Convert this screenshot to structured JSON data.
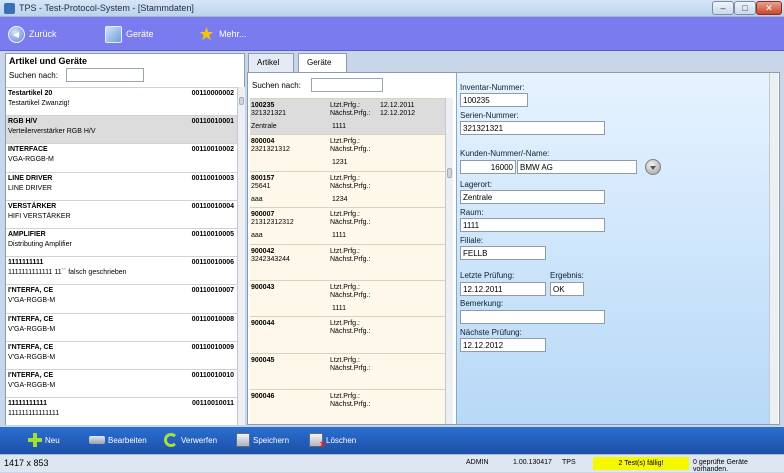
{
  "window": {
    "title": "TPS - Test-Protocol-System - [Stammdaten]",
    "minimize": "–",
    "maximize": "□",
    "close": "✕"
  },
  "toolbar": {
    "back": "Zurück",
    "devices": "Geräte",
    "more": "Mehr..."
  },
  "left": {
    "header": "Artikel und Geräte",
    "search_label": "Suchen nach:",
    "articles": [
      {
        "name": "Testartikel 20",
        "number": "00110000002",
        "desc": "Testartikel Zwanzig!"
      },
      {
        "name": "RGB H/V",
        "number": "00110010001",
        "desc": "Verteilerverstärker RGB H/V"
      },
      {
        "name": "INTERFACE",
        "number": "00110010002",
        "desc": "VGA-RGGB-M"
      },
      {
        "name": "LINE DRIVER",
        "number": "00110010003",
        "desc": "LINE DRIVER"
      },
      {
        "name": "VERSTÄRKER",
        "number": "00110010004",
        "desc": "HIFI VERSTÄRKER"
      },
      {
        "name": "AMPLIFIER",
        "number": "00110010005",
        "desc": "Distributing Amplifier"
      },
      {
        "name": "1111111111",
        "number": "00110010006",
        "desc": "1111111111111 11`` falsch geschrieben"
      },
      {
        "name": "I'NTERFA, CE",
        "number": "00110010007",
        "desc": "V'GA-RGGB-M"
      },
      {
        "name": "I'NTERFA, CE",
        "number": "00110010008",
        "desc": "V'GA-RGGB-M"
      },
      {
        "name": "I'NTERFA, CE",
        "number": "00110010009",
        "desc": "V'GA-RGGB-M"
      },
      {
        "name": "I'NTERFA, CE",
        "number": "00110010010",
        "desc": "V'GA-RGGB-M"
      },
      {
        "name": "11111111111",
        "number": "00110010011",
        "desc": "111111111111111"
      }
    ]
  },
  "tabs": [
    "Artikel",
    "Geräte"
  ],
  "devices": {
    "search_label": "Suchen nach:",
    "last_label": "Ltzt.Prfg.:",
    "next_label": "Nächst.Prfg.:",
    "items": [
      {
        "inv": "100235",
        "serial": "321321321",
        "last": "12.12.2011",
        "next": "12.12.2012",
        "location": "Zentrale",
        "room": "1111"
      },
      {
        "inv": "800004",
        "serial": "2321321312",
        "last": "",
        "next": "",
        "location": "",
        "room": "1231"
      },
      {
        "inv": "800157",
        "serial": "25641",
        "last": "",
        "next": "",
        "location": "aaa",
        "room": "1234"
      },
      {
        "inv": "900007",
        "serial": "21312312312",
        "last": "",
        "next": "",
        "location": "aaa",
        "room": "1111"
      },
      {
        "inv": "900042",
        "serial": "3242343244",
        "last": "",
        "next": "",
        "location": "",
        "room": ""
      },
      {
        "inv": "900043",
        "serial": "",
        "last": "",
        "next": "",
        "location": "",
        "room": "1111"
      },
      {
        "inv": "900044",
        "serial": "",
        "last": "",
        "next": "",
        "location": "",
        "room": ""
      },
      {
        "inv": "900045",
        "serial": "",
        "last": "",
        "next": "",
        "location": "",
        "room": ""
      },
      {
        "inv": "900046",
        "serial": "",
        "last": "",
        "next": "",
        "location": "",
        "room": ""
      }
    ]
  },
  "detail": {
    "inventory_label": "Inventar-Nummer:",
    "inventory": "100235",
    "serial_label": "Serien-Nummer:",
    "serial": "321321321",
    "customer_label": "Kunden-Nummer/-Name:",
    "customer_no": "16000",
    "customer_name": "BMW AG",
    "location_label": "Lagerort:",
    "location": "Zentrale",
    "room_label": "Raum:",
    "room": "1111",
    "branch_label": "Filiale:",
    "branch": "FELLB",
    "last_label": "Letzte Prüfung:",
    "last": "12.12.2011",
    "result_label": "Ergebnis:",
    "result": "OK",
    "remark_label": "Bemerkung:",
    "remark": "",
    "next_label": "Nächste Prüfung:",
    "next": "12.12.2012"
  },
  "bottom": {
    "new": "Neu",
    "edit": "Bearbeiten",
    "discard": "Verwerfen",
    "save": "Speichern",
    "delete": "Löschen"
  },
  "status": {
    "resolution": "1417 x 853",
    "user": "ADMIN",
    "version": "1.00.130417",
    "app": "TPS",
    "warning": "2 Test(s) fällig!",
    "info": "0 geprüfte Geräte vorhanden."
  },
  "colors": {
    "toolbar": "#7b7bf0",
    "bottombar": "#1c4fa8",
    "warning": "#f7f700"
  }
}
